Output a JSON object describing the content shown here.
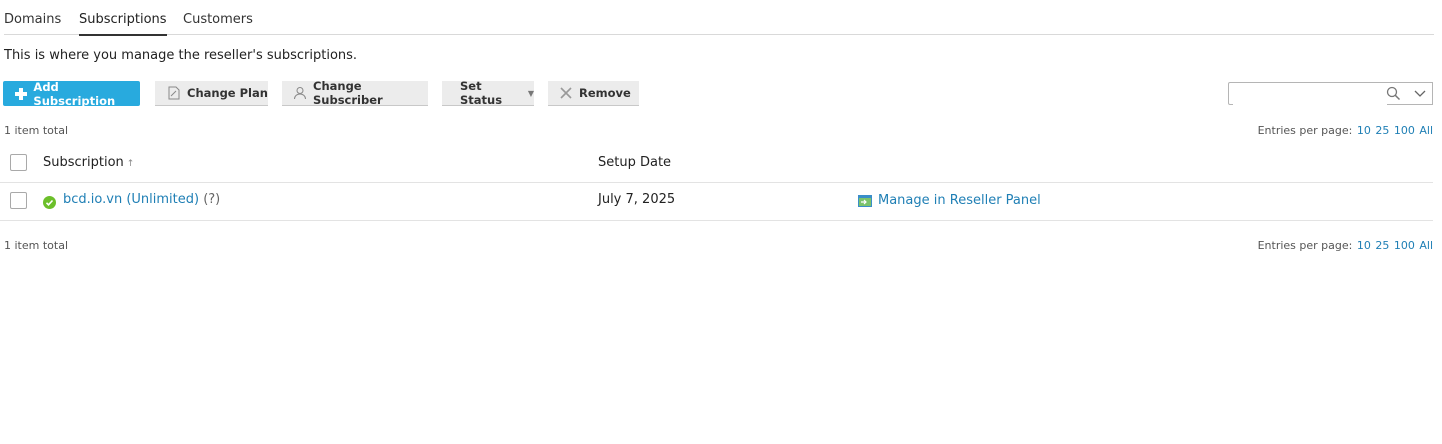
{
  "tabs": [
    {
      "label": "Domains",
      "active": false
    },
    {
      "label": "Subscriptions",
      "active": true
    },
    {
      "label": "Customers",
      "active": false
    }
  ],
  "description": "This is where you manage the reseller's subscriptions.",
  "toolbar": {
    "add_label": "Add Subscription",
    "change_plan_label": "Change Plan",
    "change_subscriber_label": "Change Subscriber",
    "set_status_label": "Set Status",
    "remove_label": "Remove"
  },
  "search": {
    "value": "",
    "placeholder": ""
  },
  "pagination": {
    "total_text": "1 item total",
    "entries_label": "Entries per page:",
    "options": [
      "10",
      "25",
      "100",
      "All"
    ]
  },
  "table": {
    "columns": [
      "Subscription",
      "Setup Date"
    ],
    "rows": [
      {
        "subscription": "bcd.io.vn (Unlimited)",
        "help": "(?)",
        "setup_date": "July 7, 2025",
        "action": "Manage in Reseller Panel",
        "status": "active"
      }
    ]
  },
  "colors": {
    "accent": "#28aade",
    "link": "#1f7fb5",
    "status_ok": "#6cbf2a"
  },
  "icons": [
    "plus-icon",
    "change-plan-icon",
    "change-subscriber-icon",
    "chevron-down-icon",
    "remove-icon",
    "search-icon",
    "sort-asc-icon",
    "status-ok-icon",
    "reseller-panel-icon"
  ]
}
